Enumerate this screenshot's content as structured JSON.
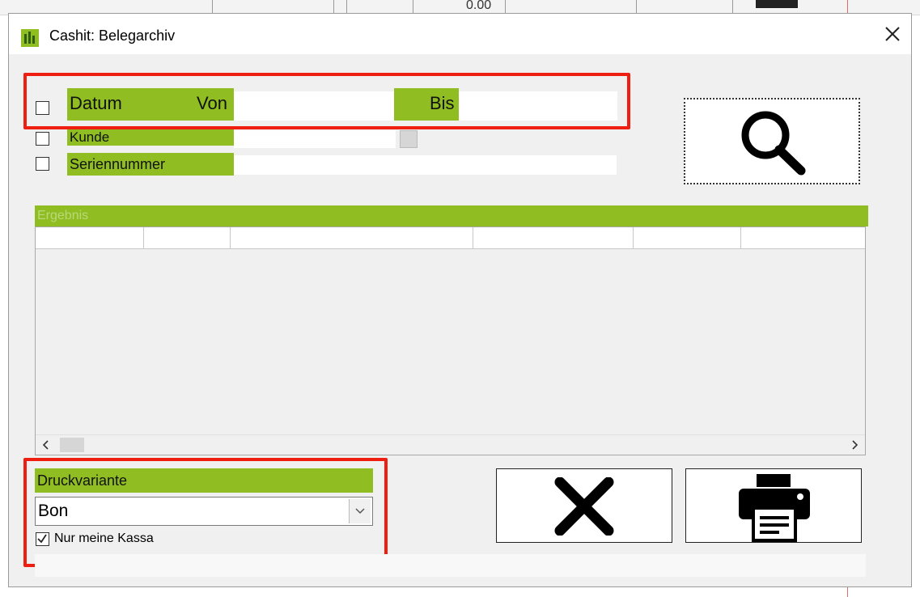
{
  "background": {
    "visible_text": "0.00"
  },
  "window": {
    "title": "Cashit: Belegarchiv"
  },
  "filters": {
    "datum": {
      "label": "Datum",
      "von_label": "Von",
      "bis_label": "Bis",
      "von_value": "",
      "bis_value": "",
      "checked": false
    },
    "kunde": {
      "label": "Kunde",
      "value": "",
      "checked": false
    },
    "seriennummer": {
      "label": "Seriennummer",
      "value": "",
      "checked": false
    }
  },
  "results": {
    "header": "Ergebnis",
    "columns": [
      "",
      "",
      "",
      "",
      "",
      ""
    ],
    "rows": []
  },
  "print": {
    "label": "Druckvariante",
    "selected": "Bon",
    "only_my_register_label": "Nur meine Kassa",
    "only_my_register_checked": true
  },
  "icons": [
    "app-icon",
    "close-icon",
    "search-icon",
    "cancel-x-icon",
    "printer-icon",
    "chevron-down-icon",
    "arrow-left-icon",
    "arrow-right-icon"
  ],
  "colors": {
    "accent_green": "#8fbd22",
    "highlight_red": "#ee1e10"
  }
}
